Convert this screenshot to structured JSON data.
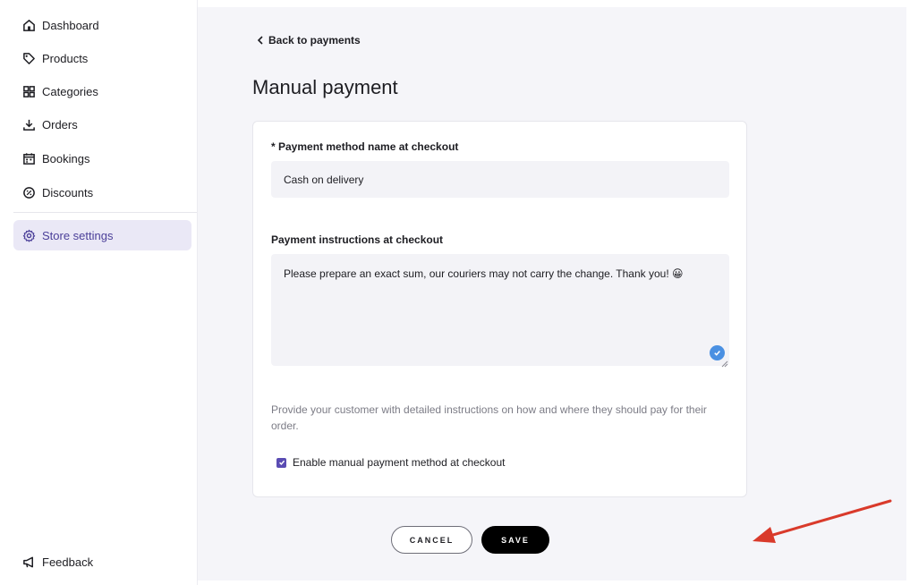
{
  "sidebar": {
    "items": [
      {
        "label": "Dashboard",
        "icon": "home-icon"
      },
      {
        "label": "Products",
        "icon": "tag-icon"
      },
      {
        "label": "Categories",
        "icon": "grid-icon"
      },
      {
        "label": "Orders",
        "icon": "download-icon"
      },
      {
        "label": "Bookings",
        "icon": "calendar-icon"
      },
      {
        "label": "Discounts",
        "icon": "discount-icon"
      },
      {
        "label": "Store settings",
        "icon": "gear-icon",
        "active": true
      }
    ],
    "feedback": {
      "label": "Feedback",
      "icon": "megaphone-icon"
    }
  },
  "main": {
    "back_label": "Back to payments",
    "title": "Manual payment",
    "name_field": {
      "label": "* Payment method name at checkout",
      "value": "Cash on delivery"
    },
    "instructions_field": {
      "label": "Payment instructions at checkout",
      "value": "Please prepare an exact sum, our couriers may not carry the change. Thank you! 😀"
    },
    "help_text": "Provide your customer with detailed instructions on how and where they should pay for their order.",
    "enable_checkbox": {
      "label": "Enable manual payment method at checkout",
      "checked": true
    },
    "cancel_label": "CANCEL",
    "save_label": "SAVE"
  },
  "colors": {
    "accent": "#5a4cb3",
    "active_bg": "#eae8f6",
    "annotation_arrow": "#d93a2b"
  }
}
